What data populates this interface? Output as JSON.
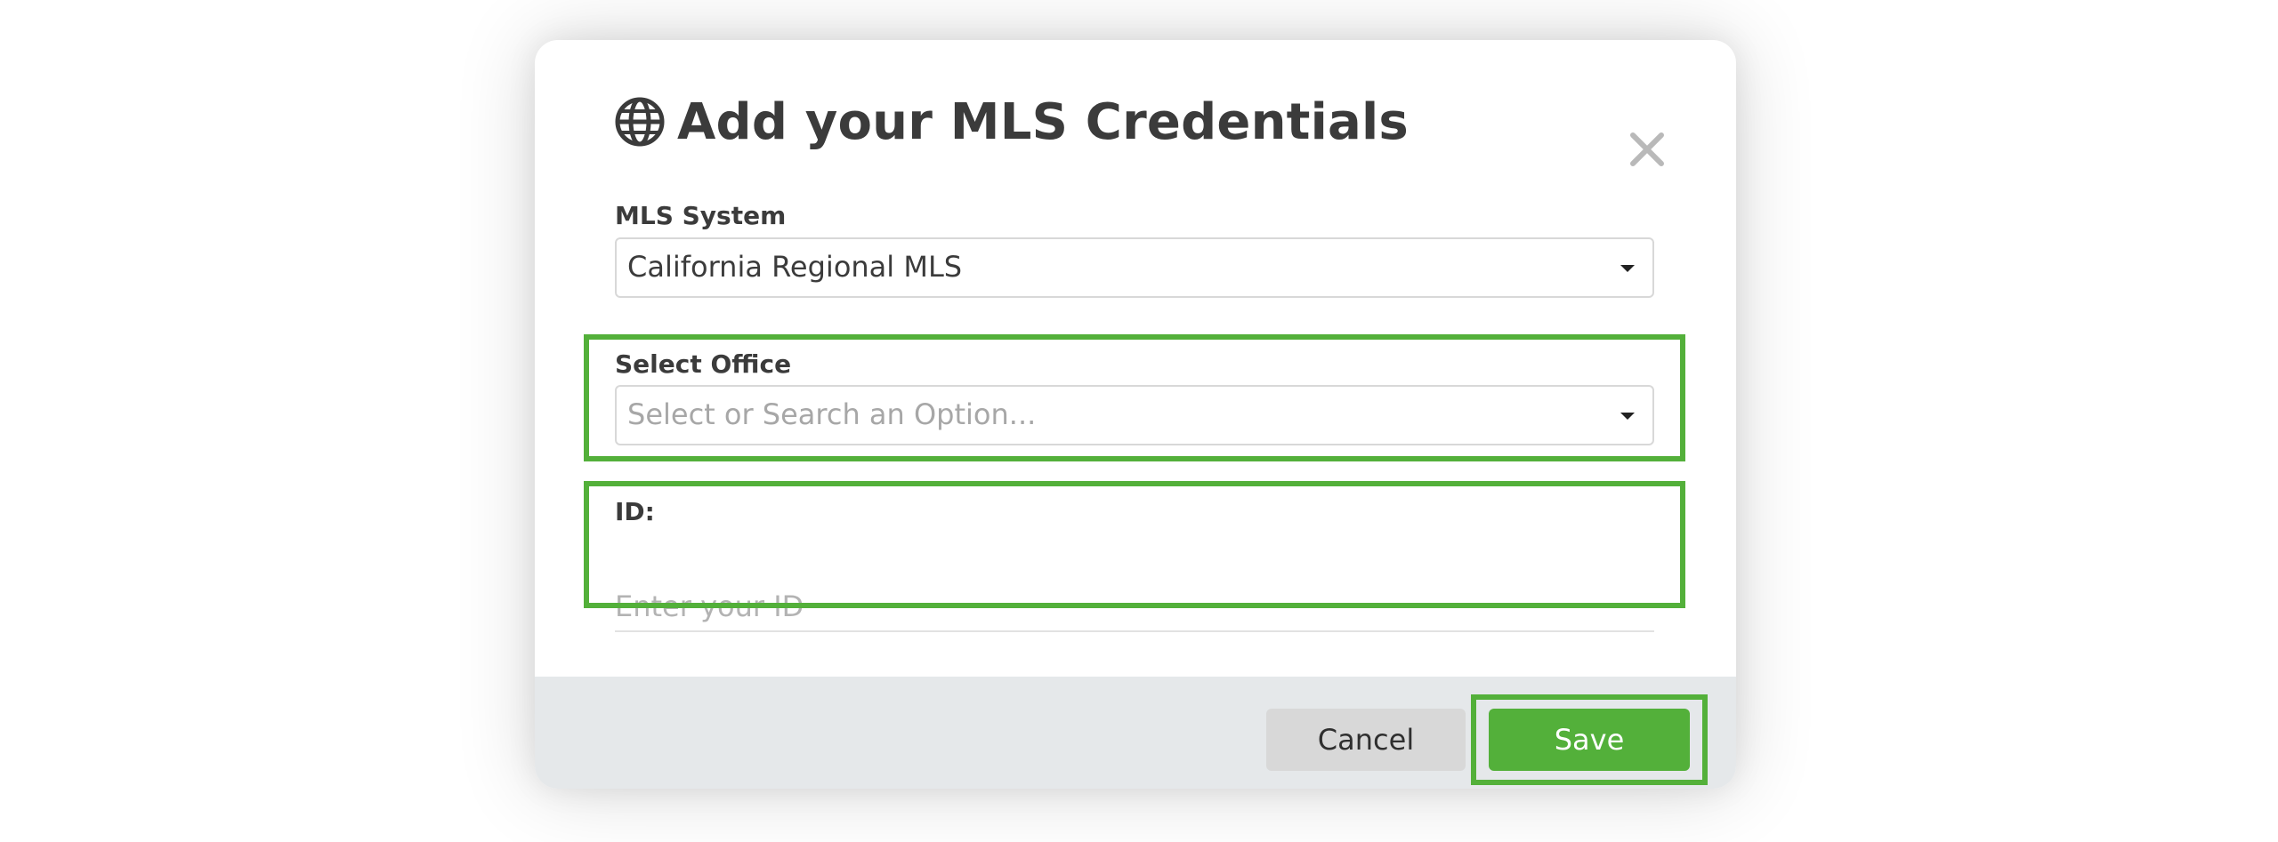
{
  "dialog": {
    "title": "Add your MLS Credentials",
    "title_icon": "globe-icon",
    "close_icon": "close-icon"
  },
  "fields": {
    "mls_system": {
      "label": "MLS System",
      "value": "California Regional MLS"
    },
    "select_office": {
      "label": "Select Office",
      "placeholder": "Select or Search an Option..."
    },
    "id": {
      "label": "ID:",
      "placeholder": "Enter your ID",
      "value": ""
    }
  },
  "footer": {
    "cancel_label": "Cancel",
    "save_label": "Save"
  },
  "colors": {
    "accent": "#53b03a",
    "footer_bg": "#e5e8ea",
    "text": "#3b3b3b",
    "placeholder": "#a7a7a7",
    "cancel_bg": "#d8d8d8"
  }
}
